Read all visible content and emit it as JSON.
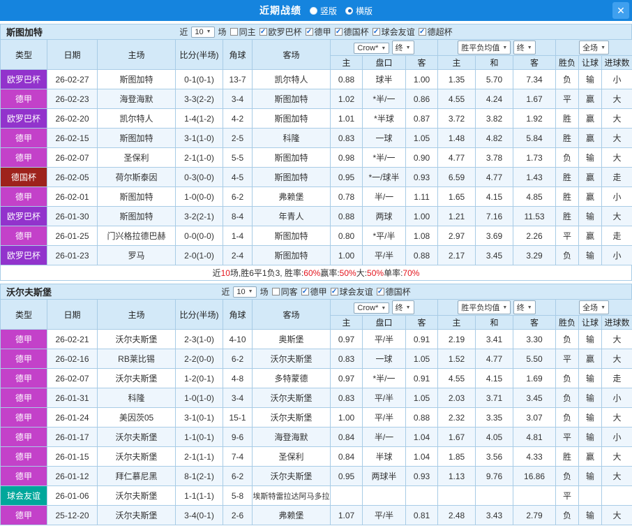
{
  "palette": {
    "titlebar_bg": "#1584de",
    "close_bg": "#3fa0ef",
    "header_bg": "#d3e9f8",
    "border": "#a8cce6",
    "row_alt": "#eef6fd",
    "red": "#e3131b",
    "green": "#009933",
    "blue": "#0a66c2",
    "league_europa": "#9233cc",
    "league_bundesliga": "#c341c9",
    "league_dfb": "#9e221c",
    "league_friendly": "#00a79b"
  },
  "titlebar": {
    "title": "近期战绩",
    "radios": [
      {
        "label": "竖版",
        "selected": false
      },
      {
        "label": "横版",
        "selected": true
      }
    ],
    "close_glyph": "✕"
  },
  "controls": {
    "near": "近",
    "matches": "场",
    "odds_source": "Crow*",
    "final": "终",
    "wdl_avg": "胜平负均值",
    "scope": "全场",
    "dropdown_arrow": "▼",
    "check_glyph": "✓"
  },
  "columns": {
    "main": [
      "类型",
      "日期",
      "主场",
      "比分(半场)",
      "角球",
      "客场"
    ],
    "sub": [
      "主",
      "盘口",
      "客",
      "主",
      "和",
      "客",
      "胜负",
      "让球",
      "进球数"
    ]
  },
  "sections": [
    {
      "team": "斯图加特",
      "count": "10",
      "checkboxes": [
        {
          "label": "同主",
          "checked": false
        },
        {
          "label": "欧罗巴杯",
          "checked": true
        },
        {
          "label": "德甲",
          "checked": true
        },
        {
          "label": "德国杯",
          "checked": true
        },
        {
          "label": "球会友谊",
          "checked": true
        },
        {
          "label": "德超杯",
          "checked": true
        }
      ],
      "rows": [
        {
          "league": "欧罗巴杯",
          "league_key": "league_europa",
          "date": "26-02-27",
          "home": "斯图加特",
          "home_focus": true,
          "score": "0-1(0-1)",
          "corner": "13-7",
          "away": "凯尔特人",
          "away_focus": false,
          "odds_home": "0.88",
          "handicap": "球半",
          "handicap_red": false,
          "odds_away": "1.00",
          "avg_home": "1.35",
          "avg_draw": "5.70",
          "avg_away": "7.34",
          "result": "负",
          "result_color": "green",
          "let_result": "输",
          "let_color": "green",
          "goal_result": "小",
          "goal_color": "green"
        },
        {
          "league": "德甲",
          "league_key": "league_bundesliga",
          "date": "26-02-23",
          "home": "海登海默",
          "home_focus": false,
          "score": "3-3(2-2)",
          "corner": "3-4",
          "away": "斯图加特",
          "away_focus": true,
          "odds_home": "1.02",
          "handicap": "*半/一",
          "handicap_red": true,
          "odds_away": "0.86",
          "avg_home": "4.55",
          "avg_draw": "4.24",
          "avg_away": "1.67",
          "result": "平",
          "result_color": "blue",
          "let_result": "赢",
          "let_color": "red",
          "goal_result": "大",
          "goal_color": "red"
        },
        {
          "league": "欧罗巴杯",
          "league_key": "league_europa",
          "date": "26-02-20",
          "home": "凯尔特人",
          "home_focus": false,
          "score": "1-4(1-2)",
          "corner": "4-2",
          "away": "斯图加特",
          "away_focus": true,
          "odds_home": "1.01",
          "handicap": "*半球",
          "handicap_red": true,
          "odds_away": "0.87",
          "avg_home": "3.72",
          "avg_draw": "3.82",
          "avg_away": "1.92",
          "result": "胜",
          "result_color": "red",
          "let_result": "赢",
          "let_color": "red",
          "goal_result": "大",
          "goal_color": "red"
        },
        {
          "league": "德甲",
          "league_key": "league_bundesliga",
          "date": "26-02-15",
          "home": "斯图加特",
          "home_focus": true,
          "score": "3-1(1-0)",
          "corner": "2-5",
          "away": "科隆",
          "away_focus": false,
          "odds_home": "0.83",
          "handicap": "一球",
          "handicap_red": false,
          "odds_away": "1.05",
          "avg_home": "1.48",
          "avg_draw": "4.82",
          "avg_away": "5.84",
          "result": "胜",
          "result_color": "red",
          "let_result": "赢",
          "let_color": "red",
          "goal_result": "大",
          "goal_color": "red"
        },
        {
          "league": "德甲",
          "league_key": "league_bundesliga",
          "date": "26-02-07",
          "home": "圣保利",
          "home_focus": false,
          "score": "2-1(1-0)",
          "corner": "5-5",
          "away": "斯图加特",
          "away_focus": true,
          "odds_home": "0.98",
          "handicap": "*半/一",
          "handicap_red": true,
          "odds_away": "0.90",
          "avg_home": "4.77",
          "avg_draw": "3.78",
          "avg_away": "1.73",
          "result": "负",
          "result_color": "green",
          "let_result": "输",
          "let_color": "green",
          "goal_result": "大",
          "goal_color": "red"
        },
        {
          "league": "德国杯",
          "league_key": "league_dfb",
          "date": "26-02-05",
          "home": "荷尔斯泰因",
          "home_focus": false,
          "score": "0-3(0-0)",
          "corner": "4-5",
          "away": "斯图加特",
          "away_focus": true,
          "odds_home": "0.95",
          "handicap": "*一/球半",
          "handicap_red": true,
          "odds_away": "0.93",
          "avg_home": "6.59",
          "avg_draw": "4.77",
          "avg_away": "1.43",
          "result": "胜",
          "result_color": "red",
          "let_result": "赢",
          "let_color": "red",
          "goal_result": "走",
          "goal_color": "red"
        },
        {
          "league": "德甲",
          "league_key": "league_bundesliga",
          "date": "26-02-01",
          "home": "斯图加特",
          "home_focus": true,
          "score": "1-0(0-0)",
          "corner": "6-2",
          "away": "弗赖堡",
          "away_focus": false,
          "odds_home": "0.78",
          "handicap": "半/一",
          "handicap_red": false,
          "odds_away": "1.11",
          "avg_home": "1.65",
          "avg_draw": "4.15",
          "avg_away": "4.85",
          "result": "胜",
          "result_color": "red",
          "let_result": "赢",
          "let_color": "red",
          "goal_result": "小",
          "goal_color": "green"
        },
        {
          "league": "欧罗巴杯",
          "league_key": "league_europa",
          "date": "26-01-30",
          "home": "斯图加特",
          "home_focus": true,
          "score": "3-2(2-1)",
          "corner": "8-4",
          "away": "年青人",
          "away_focus": false,
          "odds_home": "0.88",
          "handicap": "两球",
          "handicap_red": false,
          "odds_away": "1.00",
          "avg_home": "1.21",
          "avg_draw": "7.16",
          "avg_away": "11.53",
          "result": "胜",
          "result_color": "red",
          "let_result": "输",
          "let_color": "green",
          "goal_result": "大",
          "goal_color": "red"
        },
        {
          "league": "德甲",
          "league_key": "league_bundesliga",
          "date": "26-01-25",
          "home": "门兴格拉德巴赫",
          "home_focus": false,
          "score": "0-0(0-0)",
          "corner": "1-4",
          "away": "斯图加特",
          "away_focus": true,
          "odds_home": "0.80",
          "handicap": "*平/半",
          "handicap_red": true,
          "odds_away": "1.08",
          "avg_home": "2.97",
          "avg_draw": "3.69",
          "avg_away": "2.26",
          "result": "平",
          "result_color": "blue",
          "let_result": "赢",
          "let_color": "red",
          "goal_result": "走",
          "goal_color": "red"
        },
        {
          "league": "欧罗巴杯",
          "league_key": "league_europa",
          "date": "26-01-23",
          "home": "罗马",
          "home_focus": false,
          "score": "2-0(1-0)",
          "corner": "2-4",
          "away": "斯图加特",
          "away_focus": true,
          "odds_home": "1.00",
          "handicap": "平/半",
          "handicap_red": false,
          "odds_away": "0.88",
          "avg_home": "2.17",
          "avg_draw": "3.45",
          "avg_away": "3.29",
          "result": "负",
          "result_color": "green",
          "let_result": "输",
          "let_color": "green",
          "goal_result": "小",
          "goal_color": "green"
        }
      ],
      "summary": [
        {
          "text": "近",
          "red": false
        },
        {
          "text": "10",
          "red": true
        },
        {
          "text": "场,胜6平1负3, 胜率:",
          "red": false
        },
        {
          "text": "60%",
          "red": true
        },
        {
          "text": " 赢率:",
          "red": false
        },
        {
          "text": "50%",
          "red": true
        },
        {
          "text": " 大:",
          "red": false
        },
        {
          "text": "50%",
          "red": true
        },
        {
          "text": " 单率:",
          "red": false
        },
        {
          "text": "70%",
          "red": true
        }
      ]
    },
    {
      "team": "沃尔夫斯堡",
      "count": "10",
      "checkboxes": [
        {
          "label": "同客",
          "checked": false
        },
        {
          "label": "德甲",
          "checked": true
        },
        {
          "label": "球会友谊",
          "checked": true
        },
        {
          "label": "德国杯",
          "checked": true
        }
      ],
      "rows": [
        {
          "league": "德甲",
          "league_key": "league_bundesliga",
          "date": "26-02-21",
          "home": "沃尔夫斯堡",
          "home_focus": true,
          "score": "2-3(1-0)",
          "corner": "4-10",
          "away": "奥斯堡",
          "away_focus": false,
          "odds_home": "0.97",
          "handicap": "平/半",
          "handicap_red": false,
          "odds_away": "0.91",
          "avg_home": "2.19",
          "avg_draw": "3.41",
          "avg_away": "3.30",
          "result": "负",
          "result_color": "green",
          "let_result": "输",
          "let_color": "green",
          "goal_result": "大",
          "goal_color": "red"
        },
        {
          "league": "德甲",
          "league_key": "league_bundesliga",
          "date": "26-02-16",
          "home": "RB莱比锡",
          "home_focus": false,
          "score": "2-2(0-0)",
          "corner": "6-2",
          "away": "沃尔夫斯堡",
          "away_focus": true,
          "odds_home": "0.83",
          "handicap": "一球",
          "handicap_red": false,
          "odds_away": "1.05",
          "avg_home": "1.52",
          "avg_draw": "4.77",
          "avg_away": "5.50",
          "result": "平",
          "result_color": "blue",
          "let_result": "赢",
          "let_color": "red",
          "goal_result": "大",
          "goal_color": "red"
        },
        {
          "league": "德甲",
          "league_key": "league_bundesliga",
          "date": "26-02-07",
          "home": "沃尔夫斯堡",
          "home_focus": true,
          "score": "1-2(0-1)",
          "corner": "4-8",
          "away": "多特蒙德",
          "away_focus": false,
          "odds_home": "0.97",
          "handicap": "*半/一",
          "handicap_red": true,
          "odds_away": "0.91",
          "avg_home": "4.55",
          "avg_draw": "4.15",
          "avg_away": "1.69",
          "result": "负",
          "result_color": "green",
          "let_result": "输",
          "let_color": "green",
          "goal_result": "走",
          "goal_color": "red"
        },
        {
          "league": "德甲",
          "league_key": "league_bundesliga",
          "date": "26-01-31",
          "home": "科隆",
          "home_focus": false,
          "score": "1-0(1-0)",
          "corner": "3-4",
          "away": "沃尔夫斯堡",
          "away_focus": true,
          "odds_home": "0.83",
          "handicap": "平/半",
          "handicap_red": false,
          "odds_away": "1.05",
          "avg_home": "2.03",
          "avg_draw": "3.71",
          "avg_away": "3.45",
          "result": "负",
          "result_color": "green",
          "let_result": "输",
          "let_color": "green",
          "goal_result": "小",
          "goal_color": "green"
        },
        {
          "league": "德甲",
          "league_key": "league_bundesliga",
          "date": "26-01-24",
          "home": "美因茨05",
          "home_focus": false,
          "score": "3-1(0-1)",
          "corner": "15-1",
          "away": "沃尔夫斯堡",
          "away_focus": true,
          "odds_home": "1.00",
          "handicap": "平/半",
          "handicap_red": false,
          "odds_away": "0.88",
          "avg_home": "2.32",
          "avg_draw": "3.35",
          "avg_away": "3.07",
          "result": "负",
          "result_color": "green",
          "let_result": "输",
          "let_color": "green",
          "goal_result": "大",
          "goal_color": "red"
        },
        {
          "league": "德甲",
          "league_key": "league_bundesliga",
          "date": "26-01-17",
          "home": "沃尔夫斯堡",
          "home_focus": true,
          "score": "1-1(0-1)",
          "corner": "9-6",
          "away": "海登海默",
          "away_focus": false,
          "odds_home": "0.84",
          "handicap": "半/一",
          "handicap_red": false,
          "odds_away": "1.04",
          "avg_home": "1.67",
          "avg_draw": "4.05",
          "avg_away": "4.81",
          "result": "平",
          "result_color": "blue",
          "let_result": "输",
          "let_color": "green",
          "goal_result": "小",
          "goal_color": "green"
        },
        {
          "league": "德甲",
          "league_key": "league_bundesliga",
          "date": "26-01-15",
          "home": "沃尔夫斯堡",
          "home_focus": true,
          "score": "2-1(1-1)",
          "corner": "7-4",
          "away": "圣保利",
          "away_focus": false,
          "odds_home": "0.84",
          "handicap": "半球",
          "handicap_red": false,
          "odds_away": "1.04",
          "avg_home": "1.85",
          "avg_draw": "3.56",
          "avg_away": "4.33",
          "result": "胜",
          "result_color": "red",
          "let_result": "赢",
          "let_color": "red",
          "goal_result": "大",
          "goal_color": "red"
        },
        {
          "league": "德甲",
          "league_key": "league_bundesliga",
          "date": "26-01-12",
          "home": "拜仁慕尼黑",
          "home_focus": false,
          "score": "8-1(2-1)",
          "corner": "6-2",
          "away": "沃尔夫斯堡",
          "away_focus": true,
          "odds_home": "0.95",
          "handicap": "两球半",
          "handicap_red": false,
          "odds_away": "0.93",
          "avg_home": "1.13",
          "avg_draw": "9.76",
          "avg_away": "16.86",
          "result": "负",
          "result_color": "green",
          "let_result": "输",
          "let_color": "green",
          "goal_result": "大",
          "goal_color": "red"
        },
        {
          "league": "球会友谊",
          "league_key": "league_friendly",
          "date": "26-01-06",
          "home": "沃尔夫斯堡",
          "home_focus": true,
          "score": "1-1(1-1)",
          "corner": "5-8",
          "away": "埃斯特雷拉达阿马多拉",
          "away_focus": false,
          "odds_home": "",
          "handicap": "",
          "handicap_red": false,
          "odds_away": "",
          "avg_home": "",
          "avg_draw": "",
          "avg_away": "",
          "result": "平",
          "result_color": "blue",
          "let_result": "",
          "let_color": "",
          "goal_result": "",
          "goal_color": ""
        },
        {
          "league": "德甲",
          "league_key": "league_bundesliga",
          "date": "25-12-20",
          "home": "沃尔夫斯堡",
          "home_focus": true,
          "score": "3-4(0-1)",
          "corner": "2-6",
          "away": "弗赖堡",
          "away_focus": false,
          "odds_home": "1.07",
          "handicap": "平/半",
          "handicap_red": false,
          "odds_away": "0.81",
          "avg_home": "2.48",
          "avg_draw": "3.43",
          "avg_away": "2.79",
          "result": "负",
          "result_color": "green",
          "let_result": "输",
          "let_color": "green",
          "goal_result": "大",
          "goal_color": "red"
        }
      ]
    }
  ]
}
